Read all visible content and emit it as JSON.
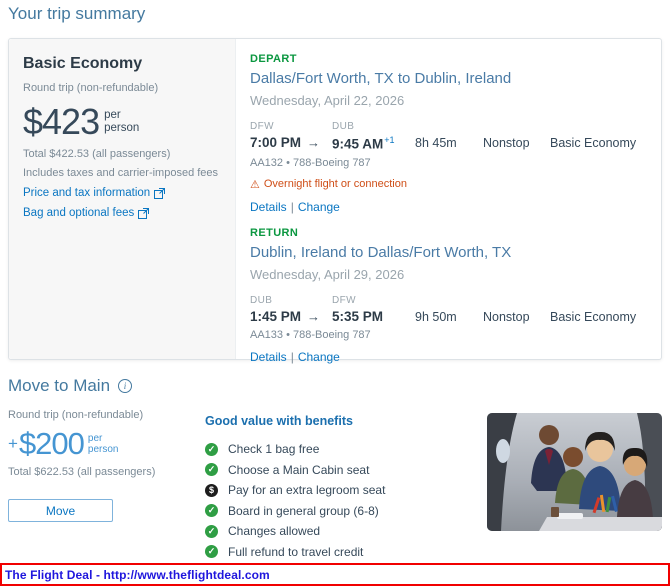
{
  "page": {
    "title": "Your trip summary"
  },
  "icons": {
    "arrow_right": "→",
    "warning": "⚠",
    "info": "i",
    "pipe": "|"
  },
  "summary_card": {
    "fare": {
      "name": "Basic Economy",
      "trip_type": "Round trip (non-refundable)",
      "price": "$423",
      "per": "per",
      "person": "person",
      "total": "Total $422.53 (all passengers)",
      "includes": "Includes taxes and carrier-imposed fees",
      "price_tax_link": "Price and tax information",
      "bag_fees_link": "Bag and optional fees"
    },
    "slices": [
      {
        "direction": "DEPART",
        "route": "Dallas/Fort Worth, TX to Dublin, Ireland",
        "date": "Wednesday, April 22, 2026",
        "origin_code": "DFW",
        "dest_code": "DUB",
        "depart_time": "7:00 PM",
        "arrive_time": "9:45 AM",
        "arrive_day_offset": "+1",
        "duration": "8h 45m",
        "stops": "Nonstop",
        "cabin": "Basic Economy",
        "flight_info": "AA132 • 788-Boeing 787",
        "warning": "Overnight flight or connection",
        "details_label": "Details",
        "change_label": "Change"
      },
      {
        "direction": "RETURN",
        "route": "Dublin, Ireland to Dallas/Fort Worth, TX",
        "date": "Wednesday, April 29, 2026",
        "origin_code": "DUB",
        "dest_code": "DFW",
        "depart_time": "1:45 PM",
        "arrive_time": "5:35 PM",
        "arrive_day_offset": "",
        "duration": "9h 50m",
        "stops": "Nonstop",
        "cabin": "Basic Economy",
        "flight_info": "AA133 • 788-Boeing 787",
        "warning": "",
        "details_label": "Details",
        "change_label": "Change"
      }
    ]
  },
  "upsell": {
    "title": "Move to Main",
    "trip_type": "Round trip (non-refundable)",
    "plus": "+",
    "price": "$200",
    "per": "per",
    "person": "person",
    "total": "Total $622.53 (all passengers)",
    "move_button": "Move",
    "benefits_title": "Good value with benefits",
    "benefits": [
      {
        "icon": "check",
        "glyph": "✓",
        "label": "Check 1 bag free"
      },
      {
        "icon": "check",
        "glyph": "✓",
        "label": "Choose a Main Cabin seat"
      },
      {
        "icon": "dollar",
        "glyph": "$",
        "label": "Pay for an extra legroom seat"
      },
      {
        "icon": "check",
        "glyph": "✓",
        "label": "Board in general group (6-8)"
      },
      {
        "icon": "check",
        "glyph": "✓",
        "label": "Changes allowed"
      },
      {
        "icon": "check",
        "glyph": "✓",
        "label": "Full refund to travel credit"
      }
    ]
  },
  "footer_banner": {
    "text": "The Flight Deal - http://www.theflightdeal.com"
  },
  "colors": {
    "heading_blue": "#44799f",
    "link_blue": "#0a76c2",
    "dark_text": "#36495a",
    "muted_gray": "#7b8a96",
    "green_label": "#0b9740",
    "warning_orange": "#cf4e17",
    "upsell_blue": "#4595d2",
    "check_green": "#2f9e44",
    "banner_border_red": "#f10000",
    "banner_text_blue": "#1f16dd",
    "panel_gray": "#f7f7f7"
  }
}
